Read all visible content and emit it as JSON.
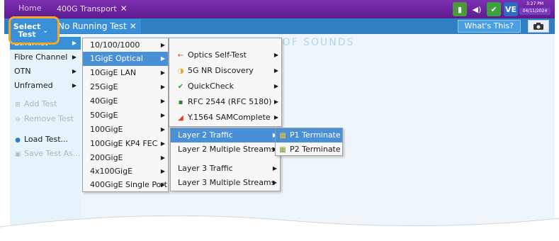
{
  "titlebar": {
    "tab_home": "Home",
    "tab_transport": "400G Transport",
    "tab_close": "✕",
    "clock_time": "3:27 PM",
    "clock_date": "04/11/2024",
    "tray_vnc": "VE"
  },
  "toolbar": {
    "select_test_label": "Select Test",
    "running_tab": "No Running Test",
    "running_close": "✕",
    "whats_this": "What's This?"
  },
  "left_menu": [
    {
      "label": "Ethernet",
      "has_sub": true,
      "state": "selected"
    },
    {
      "label": "Fibre Channel",
      "has_sub": true,
      "state": "normal"
    },
    {
      "label": "OTN",
      "has_sub": true,
      "state": "normal"
    },
    {
      "label": "Unframed",
      "has_sub": true,
      "state": "normal"
    },
    {
      "label": "Add Test",
      "icon": "add-icon",
      "state": "disabled"
    },
    {
      "label": "Remove Test",
      "icon": "remove-icon",
      "state": "disabled"
    },
    {
      "label": "Load Test...",
      "icon": "load-icon",
      "state": "normal"
    },
    {
      "label": "Save Test As...",
      "icon": "save-icon",
      "state": "disabled"
    }
  ],
  "menu_ethernet": [
    {
      "label": "10/100/1000",
      "has_sub": true
    },
    {
      "label": "1GigE Optical",
      "has_sub": true,
      "selected": true
    },
    {
      "label": "10GigE LAN",
      "has_sub": true
    },
    {
      "label": "25GigE",
      "has_sub": true
    },
    {
      "label": "40GigE",
      "has_sub": true
    },
    {
      "label": "50GigE",
      "has_sub": true
    },
    {
      "label": "100GigE",
      "has_sub": true
    },
    {
      "label": "100GigE KP4 FEC",
      "has_sub": true
    },
    {
      "label": "200GigE",
      "has_sub": true
    },
    {
      "label": "4x100GigE",
      "has_sub": true
    },
    {
      "label": "400GigE Single Port",
      "has_sub": true
    }
  ],
  "menu_1gige": [
    {
      "label": "Optics Self-Test",
      "icon": "arrow-left-icon",
      "has_sub": true
    },
    {
      "label": "5G NR Discovery",
      "icon": "discovery-icon",
      "has_sub": true
    },
    {
      "label": "QuickCheck",
      "icon": "check-icon",
      "has_sub": true
    },
    {
      "label": "RFC 2544 (RFC 5180)",
      "icon": "rfc-icon",
      "has_sub": true
    },
    {
      "label": "Y.1564 SAMComplete",
      "icon": "chart-icon",
      "has_sub": true
    }
  ],
  "menu_layers": [
    {
      "label": "Layer 2 Traffic",
      "has_sub": true,
      "selected": true
    },
    {
      "label": "Layer 2 Multiple Streams",
      "has_sub": true
    },
    {
      "label": "Layer 3 Traffic",
      "has_sub": true
    },
    {
      "label": "Layer 3 Multiple Streams",
      "has_sub": true
    }
  ],
  "menu_terminate": [
    {
      "label": "P1 Terminate",
      "icon": "port-icon",
      "selected": true
    },
    {
      "label": "P2 Terminate",
      "icon": "port-icon"
    }
  ],
  "background_text": "WAVE OF SOUNDS",
  "colors": {
    "titlebar": "#6a24a0",
    "toolbar": "#2f7fc2",
    "highlight": "#f5a623",
    "selection": "#4a90d9"
  }
}
